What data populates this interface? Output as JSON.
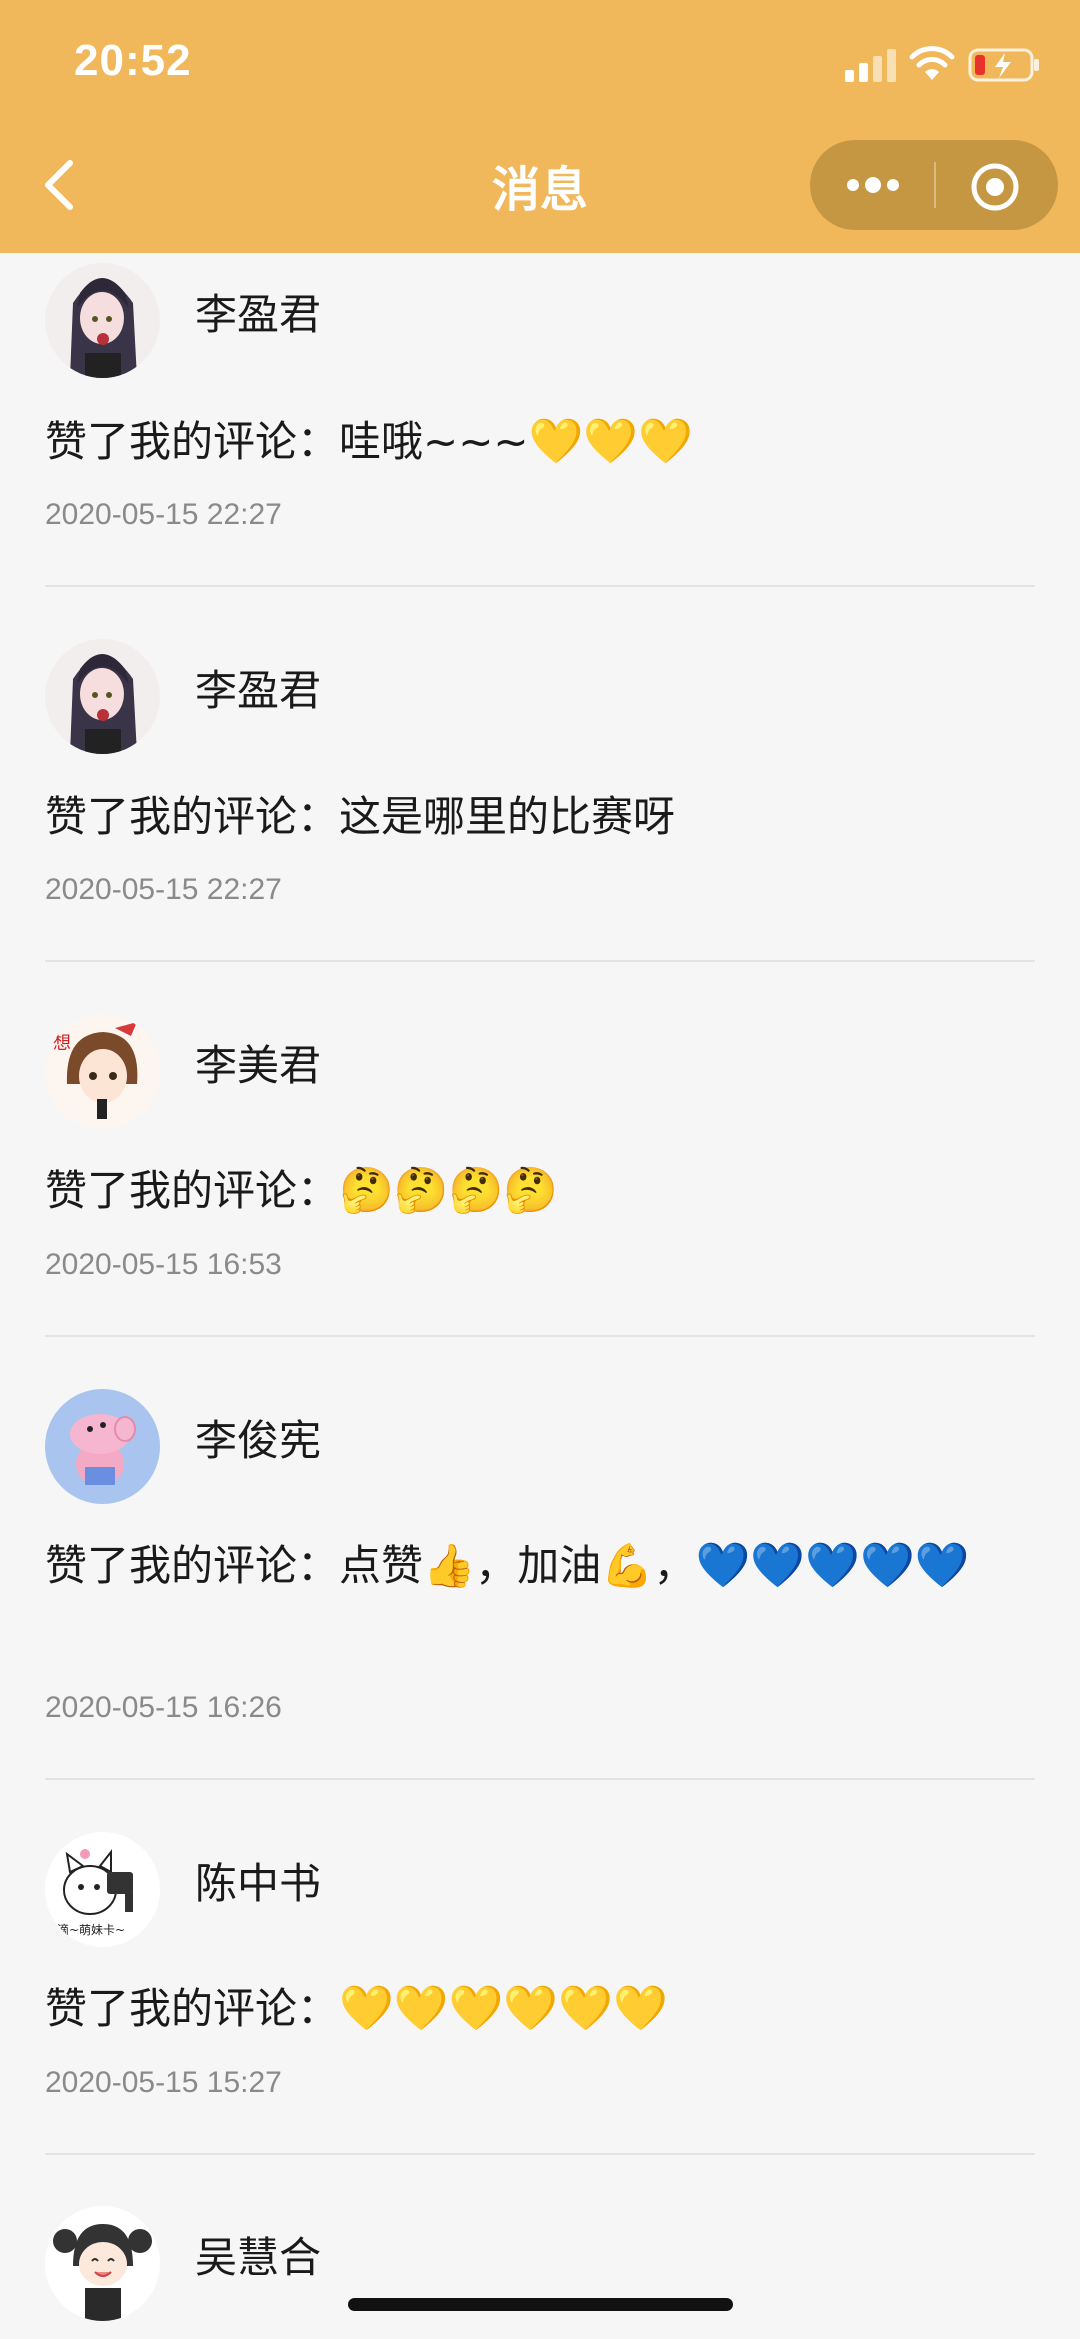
{
  "status_bar": {
    "time": "20:52"
  },
  "nav": {
    "title": "消息"
  },
  "colors": {
    "header": "#f0b85a",
    "heart_yellow": "#f5c335",
    "heart_blue": "#1a5ce0"
  },
  "messages": [
    {
      "name": "李盈君",
      "avatar": "anime-girl-avatar",
      "prefix": "赞了我的评论：",
      "text": "哇哦~~~",
      "emoji": "💛💛💛",
      "time": "2020-05-15 22:27"
    },
    {
      "name": "李盈君",
      "avatar": "anime-girl-avatar",
      "prefix": "赞了我的评论：",
      "text": "这是哪里的比赛呀",
      "emoji": "",
      "time": "2020-05-15 22:27"
    },
    {
      "name": "李美君",
      "avatar": "cartoon-girl-avatar",
      "prefix": "赞了我的评论：",
      "text": "",
      "emoji": "🤔🤔🤔🤔",
      "time": "2020-05-15 16:53"
    },
    {
      "name": "李俊宪",
      "avatar": "pig-avatar",
      "prefix": "赞了我的评论：",
      "text": "点赞👍，加油💪，",
      "emoji": "💙💙💙💙💙",
      "time": "2020-05-15 16:26"
    },
    {
      "name": "陈中书",
      "avatar": "cat-camera-avatar",
      "prefix": "赞了我的评论：",
      "text": "",
      "emoji": "💛💛💛💛💛💛",
      "time": "2020-05-15 15:27"
    },
    {
      "name": "吴慧合",
      "avatar": "chibi-girl-avatar"
    }
  ]
}
